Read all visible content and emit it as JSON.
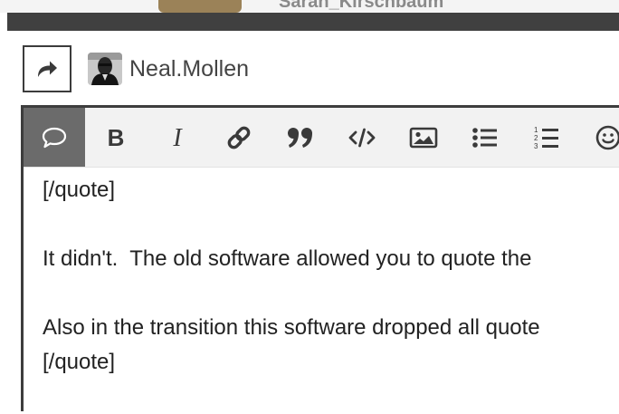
{
  "background": {
    "author_name": "Sarah_Kirschbaum"
  },
  "composer": {
    "reply_action_icon": "share-arrow-icon",
    "user": {
      "name": "Neal.Mollen",
      "avatar_icon": "user-avatar-photo"
    },
    "toolbar": [
      {
        "name": "toggle-preview-button",
        "icon": "speech-bubble-icon",
        "active": true
      },
      {
        "name": "bold-button",
        "icon": "bold-icon",
        "glyph": "B"
      },
      {
        "name": "italic-button",
        "icon": "italic-icon",
        "glyph": "I"
      },
      {
        "name": "link-button",
        "icon": "link-icon"
      },
      {
        "name": "blockquote-button",
        "icon": "quote-icon"
      },
      {
        "name": "code-button",
        "icon": "code-icon",
        "glyph": "</>"
      },
      {
        "name": "image-button",
        "icon": "image-icon"
      },
      {
        "name": "bullet-list-button",
        "icon": "bullet-list-icon"
      },
      {
        "name": "numbered-list-button",
        "icon": "numbered-list-icon"
      },
      {
        "name": "emoji-button",
        "icon": "smiley-icon"
      }
    ],
    "text_lines": [
      "[/quote]",
      "",
      "It didn't.  The old software allowed you to quote the",
      "",
      "Also in the transition this software dropped all quote",
      "[/quote]"
    ]
  },
  "colors": {
    "frame_dark": "#404040",
    "toolbar_bg": "#f2f2f2",
    "active_button": "#6b6b6b",
    "bg_avatar": "#9b8258"
  }
}
